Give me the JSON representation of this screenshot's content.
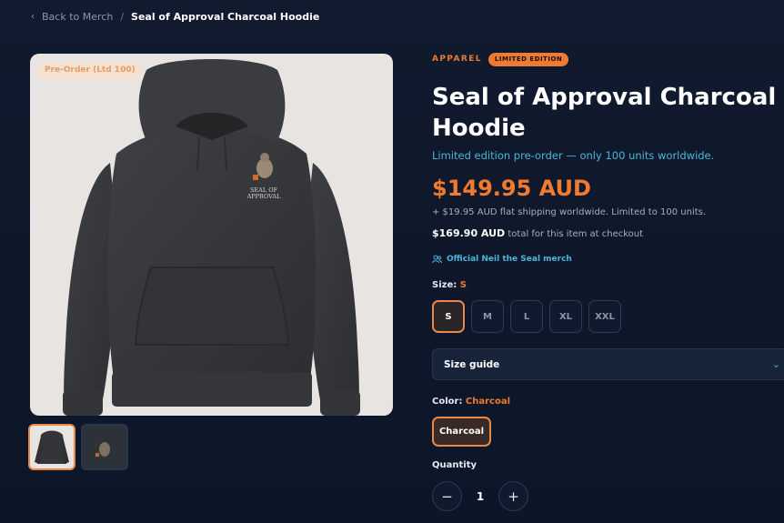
{
  "breadcrumb": {
    "back_label": "Back to Merch",
    "separator": "/",
    "current": "Seal of Approval Charcoal Hoodie"
  },
  "image": {
    "badge": "Pre-Order (Ltd 100)",
    "print_line1": "SEAL OF",
    "print_line2": "APPROVAL"
  },
  "product": {
    "category": "APPAREL",
    "badge": "LIMITED EDITION",
    "title": "Seal of Approval Charcoal Hoodie",
    "subtitle": "Limited edition pre-order — only 100 units worldwide.",
    "price": "$149.95 AUD",
    "shipping_note": "+ $19.95 AUD flat shipping worldwide. Limited to 100 units.",
    "total_amount": "$169.90 AUD",
    "total_suffix": "total for this item at checkout",
    "official": "Official Neil the Seal merch"
  },
  "size": {
    "label": "Size:",
    "selected": "S",
    "options": [
      "S",
      "M",
      "L",
      "XL",
      "XXL"
    ]
  },
  "size_guide": {
    "label": "Size guide"
  },
  "color": {
    "label": "Color:",
    "selected": "Charcoal",
    "option": "Charcoal"
  },
  "quantity": {
    "label": "Quantity",
    "value": "1",
    "minus": "−",
    "plus": "+"
  },
  "colors": {
    "accent": "#f07a30",
    "link": "#4bb6da",
    "background": "#0f1729"
  }
}
